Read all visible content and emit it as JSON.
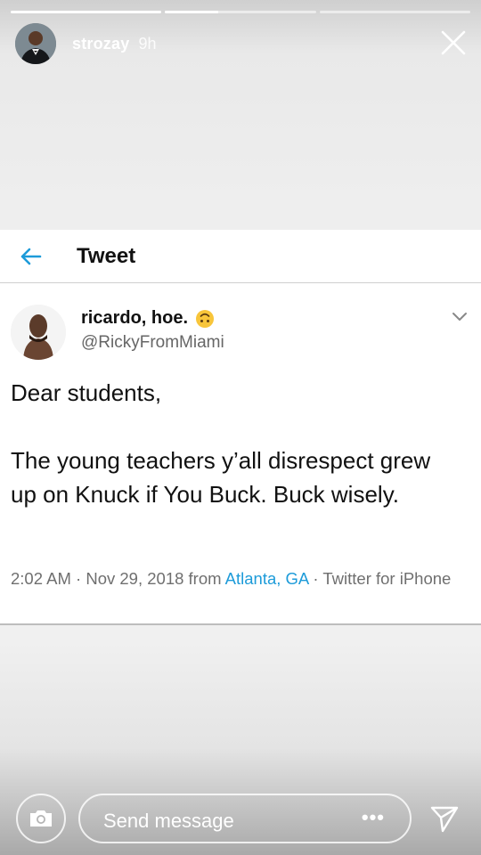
{
  "story": {
    "progress": [
      1.0,
      0.35,
      0.0
    ],
    "username": "strozay",
    "time": "9h",
    "close_icon": "close-icon"
  },
  "tweet": {
    "header_title": "Tweet",
    "back_icon": "back-arrow-icon",
    "display_name": "ricardo, hoe.",
    "name_emoji": "upside-down-face-emoji",
    "handle": "@RickyFromMiami",
    "text": "Dear students,\n\nThe young teachers y’all disrespect grew up on Knuck if You Buck. Buck wisely.",
    "meta": {
      "time": "2:02 AM",
      "sep1": " · ",
      "date": "Nov 29, 2018",
      "from": " from ",
      "location": "Atlanta, GA",
      "sep2": " · ",
      "client": "Twitter for iPhone"
    },
    "colors": {
      "link": "#1d9bd9",
      "text": "#111111",
      "meta": "#6f6f6f"
    }
  },
  "footer": {
    "camera_icon": "camera-icon",
    "placeholder": "Send message",
    "more": "•••",
    "send_icon": "send-icon"
  }
}
